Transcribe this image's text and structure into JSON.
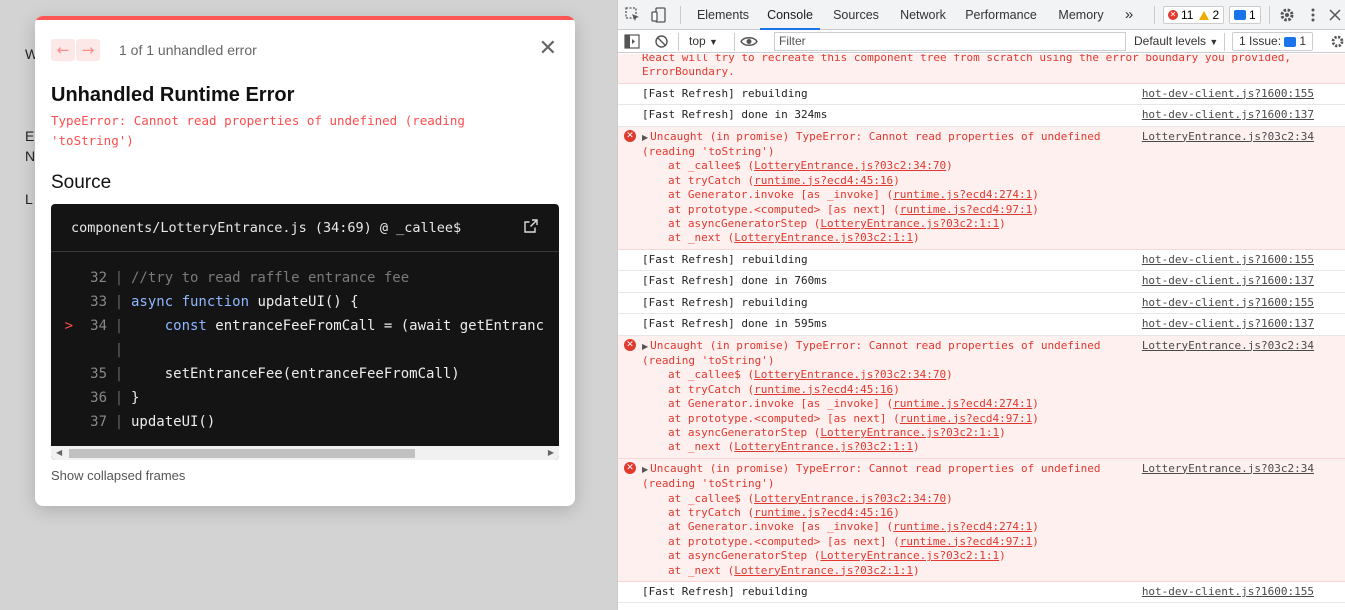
{
  "page": {
    "fragments": [
      "W",
      "E",
      "N",
      "L"
    ]
  },
  "overlay": {
    "prev_icon": "←",
    "next_icon": "→",
    "counter": "1 of 1 unhandled error",
    "close_icon": "✕",
    "title": "Unhandled Runtime Error",
    "error_message": "TypeError: Cannot read properties of undefined (reading 'toString')",
    "source_heading": "Source",
    "source_file": "components/LotteryEntrance.js (34:69) @ _callee$",
    "code_lines": [
      {
        "marker": "",
        "num": "32",
        "text": "//try to read raffle entrance fee"
      },
      {
        "marker": "",
        "num": "33",
        "kw": "async function",
        "text": " updateUI() {"
      },
      {
        "marker": ">",
        "num": "34",
        "indent": "    ",
        "kw": "const",
        "text": " entranceFeeFromCall = (await getEntranc"
      },
      {
        "marker": "",
        "num": "",
        "text": ""
      },
      {
        "marker": "",
        "num": "35",
        "indent": "    ",
        "text": "setEntranceFee(entranceFeeFromCall)"
      },
      {
        "marker": "",
        "num": "36",
        "text": "}"
      },
      {
        "marker": "",
        "num": "37",
        "text": "updateUI()"
      }
    ],
    "show_collapsed": "Show collapsed frames"
  },
  "devtools": {
    "tabs": [
      "Elements",
      "Console",
      "Sources",
      "Network",
      "Performance",
      "Memory"
    ],
    "active_tab": "Console",
    "more_tabs": "»",
    "error_count": "11",
    "warning_count": "2",
    "message_count": "1",
    "context": "top",
    "filter_placeholder": "Filter",
    "levels": "Default levels",
    "issues_label": "1 Issue:",
    "issues_count": "1",
    "truncated_text": "React will try to recreate this component tree from scratch using the error boundary you provided,",
    "truncated_text_2": "ErrorBoundary.",
    "stack": [
      {
        "fn": "at _callee$",
        "loc": "LotteryEntrance.js?03c2:34:70"
      },
      {
        "fn": "at tryCatch",
        "loc": "runtime.js?ecd4:45:16"
      },
      {
        "fn": "at Generator.invoke [as _invoke]",
        "loc": "runtime.js?ecd4:274:1"
      },
      {
        "fn": "at prototype.<computed> [as next]",
        "loc": "runtime.js?ecd4:97:1"
      },
      {
        "fn": "at asyncGeneratorStep",
        "loc": "LotteryEntrance.js?03c2:1:1"
      },
      {
        "fn": "at _next",
        "loc": "LotteryEntrance.js?03c2:1:1"
      }
    ],
    "uncaught_line1": "Uncaught (in promise) TypeError: Cannot read properties of undefined",
    "uncaught_line2": "(reading 'toString')",
    "uncaught_short1": "Uncaught (in promise) TypeError: Cannot read properties of undefined",
    "uncaught_src": "LotteryEntrance.js?03c2:34",
    "hmr_src_155": "hot-dev-client.js?1600:155",
    "hmr_src_137": "hot-dev-client.js?1600:137",
    "rebuilding": "[Fast Refresh] rebuilding",
    "done_324": "[Fast Refresh] done in 324ms",
    "done_760": "[Fast Refresh] done in 760ms",
    "done_595": "[Fast Refresh] done in 595ms",
    "prompt": "›",
    "colors": {
      "error": "#e0392f",
      "accent": "#1a73e8",
      "error_bg": "#fff0f0"
    }
  }
}
